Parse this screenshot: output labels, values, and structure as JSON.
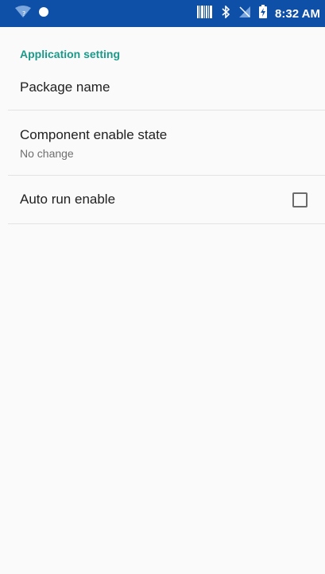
{
  "status_bar": {
    "time": "8:32 AM",
    "icons": [
      "wifi-question-icon",
      "circle-icon",
      "barcode-icon",
      "bluetooth-icon",
      "no-signal-icon",
      "battery-charging-icon"
    ]
  },
  "settings": {
    "section_header": "Application setting",
    "items": [
      {
        "title": "Package name"
      },
      {
        "title": "Component enable state",
        "summary": "No change"
      },
      {
        "title": "Auto run enable",
        "checked": false
      }
    ]
  },
  "colors": {
    "status_bar_bg": "#0e4fa8",
    "accent": "#1b9a8a",
    "background": "#fafafa"
  }
}
